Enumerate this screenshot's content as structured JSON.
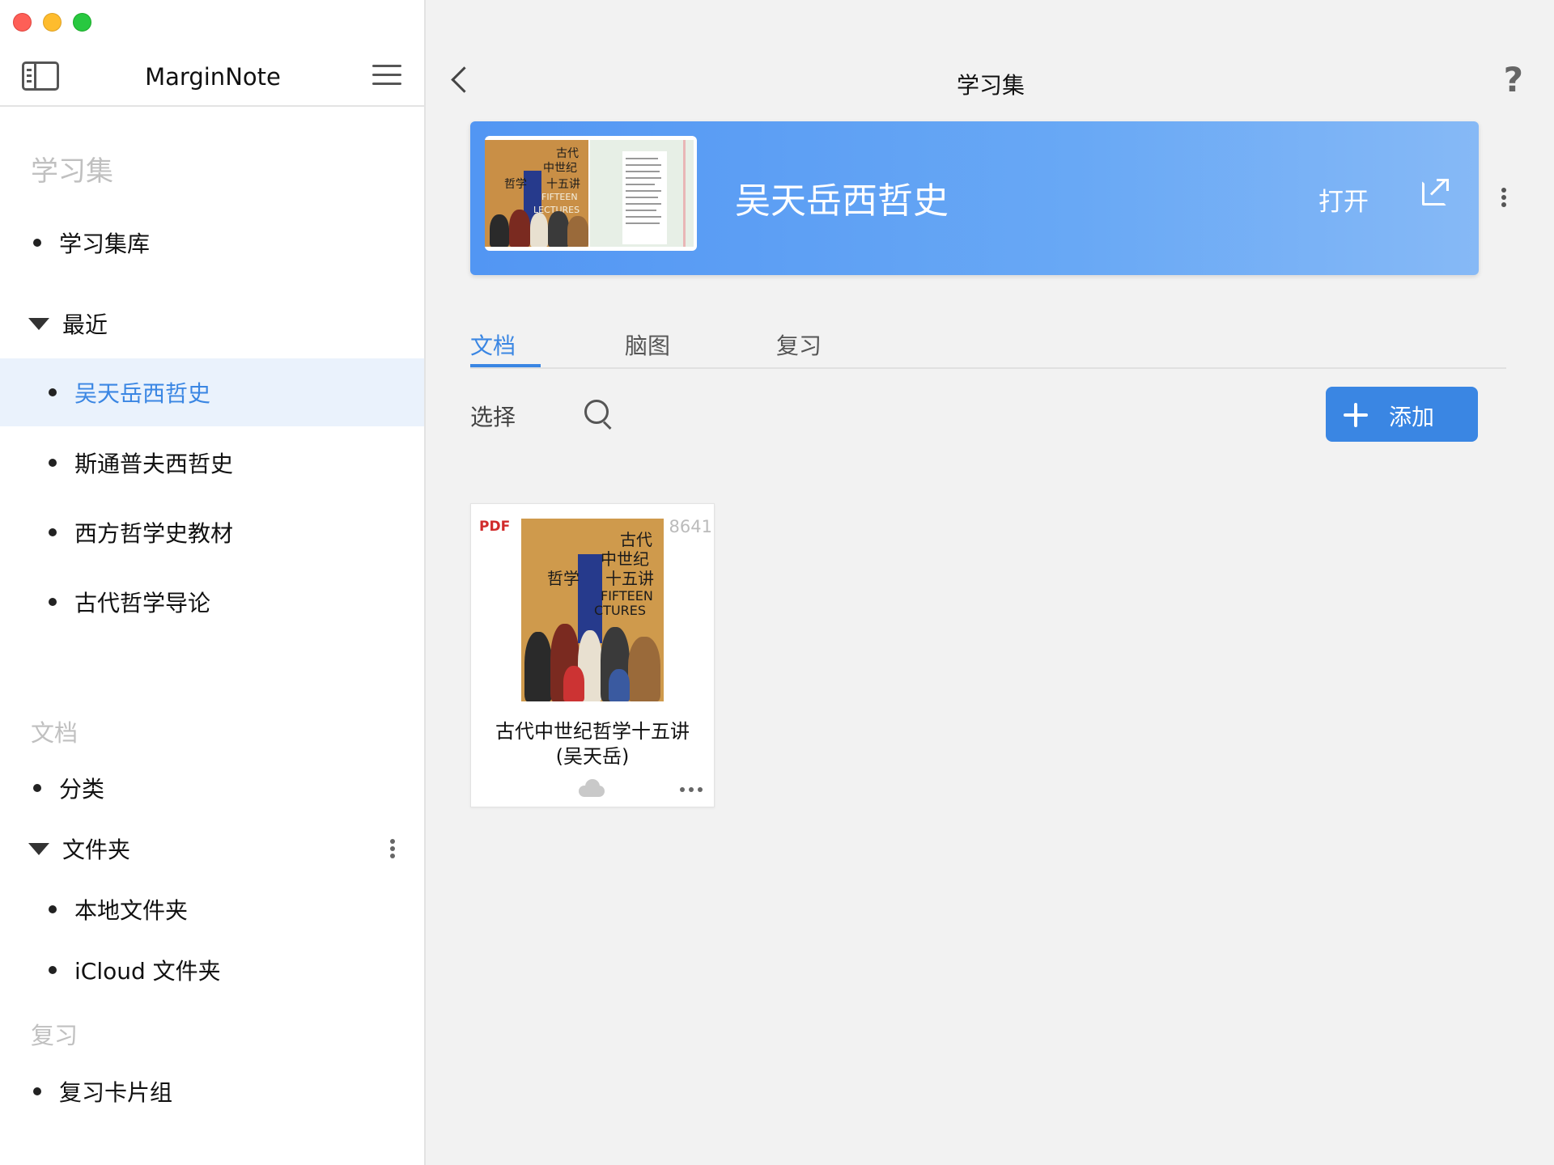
{
  "window": {
    "app_name": "MarginNote",
    "colors": {
      "accent": "#3a86e3",
      "selected_bg": "#eaf2fc",
      "banner": "#5296f3",
      "pdf_tag": "#d12b2b"
    }
  },
  "sidebar": {
    "section_collections": "学习集",
    "collections_library": "学习集库",
    "recent_header": "最近",
    "recent_items": [
      "吴天岳西哲史",
      "斯通普夫西哲史",
      "西方哲学史教材",
      "古代哲学导论"
    ],
    "section_documents": "文档",
    "categories": "分类",
    "folders_header": "文件夹",
    "folder_items": [
      "本地文件夹",
      "iCloud 文件夹"
    ],
    "section_review": "复习",
    "review_decks": "复习卡片组"
  },
  "main": {
    "title": "学习集",
    "help": "?",
    "banner": {
      "title": "吴天岳西哲史",
      "open_label": "打开"
    },
    "tabs": [
      "文档",
      "脑图",
      "复习"
    ],
    "toolbar": {
      "select_label": "选择",
      "add_label": "添加"
    },
    "document": {
      "type_tag": "PDF",
      "page_count": "8641",
      "name_line1": "古代中世纪哲学十五讲",
      "name_line2": "(吴天岳)"
    }
  }
}
